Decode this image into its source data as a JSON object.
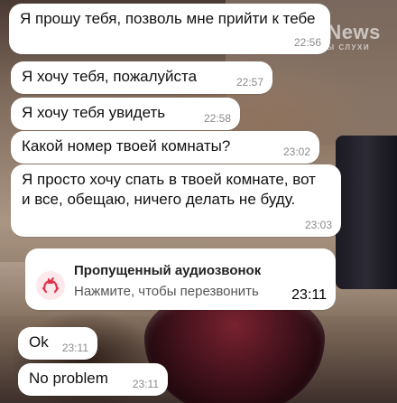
{
  "watermark": {
    "title": "TopNews",
    "subtitle": "ФАКТЫ СЛУХИ"
  },
  "messages": [
    {
      "text": "Я прошу тебя, позволь мне прийти к тебе",
      "time": "22:56"
    },
    {
      "text": "Я хочу тебя, пожалуйста",
      "time": "22:57"
    },
    {
      "text": "Я хочу тебя увидеть",
      "time": "22:58"
    },
    {
      "text": "Какой номер твоей комнаты?",
      "time": "23:02"
    },
    {
      "text": "Я просто хочу спать в твоей комнате, вот и все, обещаю, ничего делать не буду.",
      "time": "23:03"
    }
  ],
  "missed_call": {
    "icon": "missed-call-icon",
    "title": "Пропущенный аудиозвонок",
    "subtitle": "Нажмите, чтобы перезвонить",
    "time": "23:11",
    "icon_color": "#e0344b"
  },
  "replies": [
    {
      "text": "Ok",
      "time": "23:11"
    },
    {
      "text": "No problem",
      "time": "23:11"
    }
  ]
}
